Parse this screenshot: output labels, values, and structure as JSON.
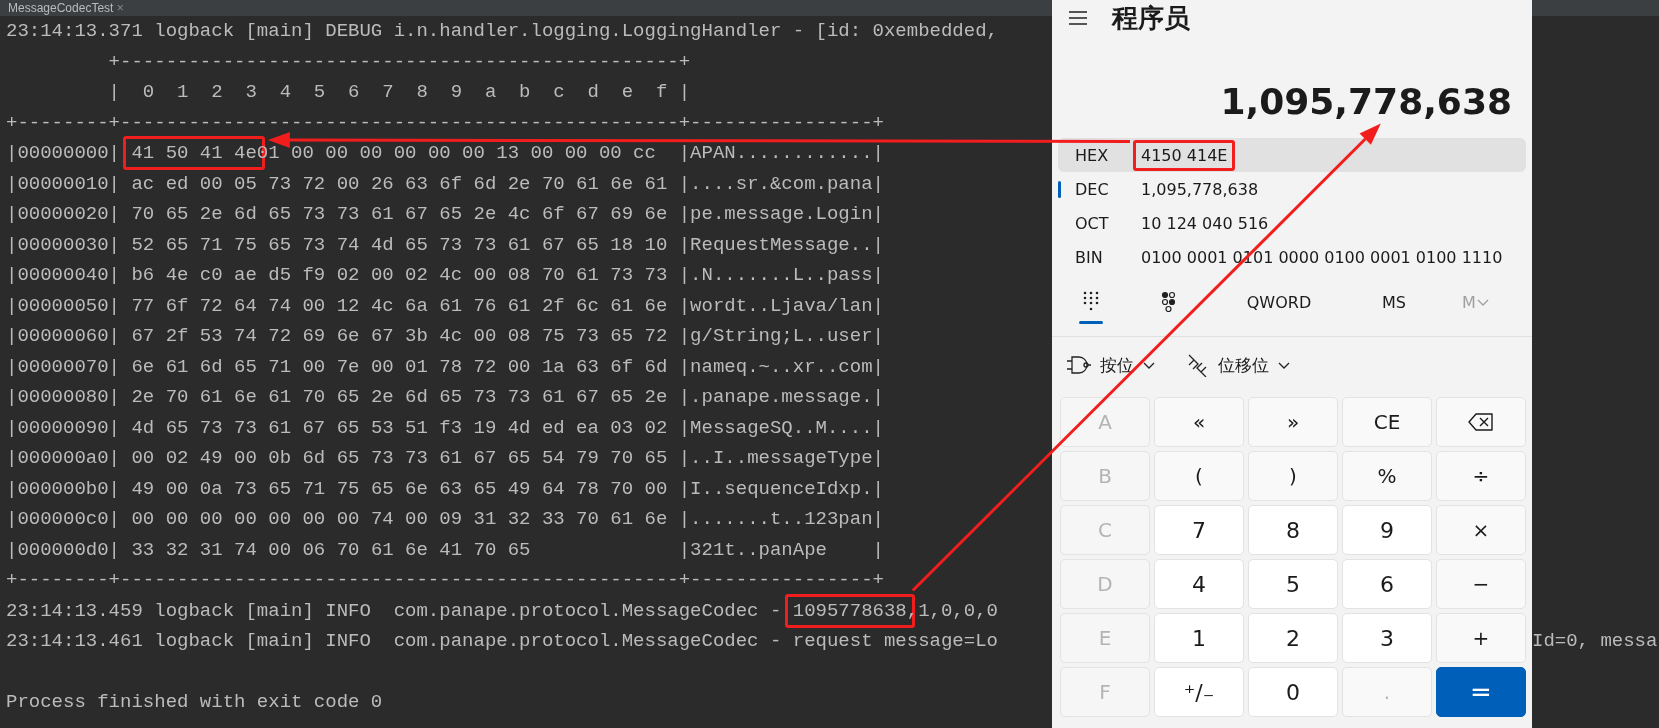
{
  "tab": {
    "title": "MessageCodecTest",
    "close": "×"
  },
  "console": {
    "lines": [
      {
        "kind": "text",
        "text": "23:14:13.371 logback [main] DEBUG i.n.handler.logging.LoggingHandler - [id: 0xembedded,"
      },
      {
        "kind": "text",
        "text": "         +-------------------------------------------------+"
      },
      {
        "kind": "text",
        "text": "         |  0  1  2  3  4  5  6  7  8  9  a  b  c  d  e  f |"
      },
      {
        "kind": "text",
        "text": "+--------+-------------------------------------------------+----------------+"
      },
      {
        "kind": "hex",
        "address": "|00000000|",
        "marked": "41 50 41 4e",
        "bytes": "01 00 00 00 00 00 00 13 00 00 00 cc",
        "ascii": "|APAN............|"
      },
      {
        "kind": "hex",
        "address": "|00000010|",
        "bytes": "ac ed 00 05 73 72 00 26 63 6f 6d 2e 70 61 6e 61",
        "ascii": "|....sr.&com.pana|"
      },
      {
        "kind": "hex",
        "address": "|00000020|",
        "bytes": "70 65 2e 6d 65 73 73 61 67 65 2e 4c 6f 67 69 6e",
        "ascii": "|pe.message.Login|"
      },
      {
        "kind": "hex",
        "address": "|00000030|",
        "bytes": "52 65 71 75 65 73 74 4d 65 73 73 61 67 65 18 10",
        "ascii": "|RequestMessage..|"
      },
      {
        "kind": "hex",
        "address": "|00000040|",
        "bytes": "b6 4e c0 ae d5 f9 02 00 02 4c 00 08 70 61 73 73",
        "ascii": "|.N.......L..pass|"
      },
      {
        "kind": "hex",
        "address": "|00000050|",
        "bytes": "77 6f 72 64 74 00 12 4c 6a 61 76 61 2f 6c 61 6e",
        "ascii": "|wordt..Ljava/lan|"
      },
      {
        "kind": "hex",
        "address": "|00000060|",
        "bytes": "67 2f 53 74 72 69 6e 67 3b 4c 00 08 75 73 65 72",
        "ascii": "|g/String;L..user|"
      },
      {
        "kind": "hex",
        "address": "|00000070|",
        "bytes": "6e 61 6d 65 71 00 7e 00 01 78 72 00 1a 63 6f 6d",
        "ascii": "|nameq.~..xr..com|"
      },
      {
        "kind": "hex",
        "address": "|00000080|",
        "bytes": "2e 70 61 6e 61 70 65 2e 6d 65 73 73 61 67 65 2e",
        "ascii": "|.panape.message.|"
      },
      {
        "kind": "hex",
        "address": "|00000090|",
        "bytes": "4d 65 73 73 61 67 65 53 51 f3 19 4d ed ea 03 02",
        "ascii": "|MessageSQ..M....|"
      },
      {
        "kind": "hex",
        "address": "|000000a0|",
        "bytes": "00 02 49 00 0b 6d 65 73 73 61 67 65 54 79 70 65",
        "ascii": "|..I..messageType|"
      },
      {
        "kind": "hex",
        "address": "|000000b0|",
        "bytes": "49 00 0a 73 65 71 75 65 6e 63 65 49 64 78 70 00",
        "ascii": "|I..sequenceIdxp.|"
      },
      {
        "kind": "hex",
        "address": "|000000c0|",
        "bytes": "00 00 00 00 00 00 00 74 00 09 31 32 33 70 61 6e",
        "ascii": "|.......t..123pan|"
      },
      {
        "kind": "hex",
        "address": "|000000d0|",
        "bytes": "33 32 31 74 00 06 70 61 6e 41 70 65",
        "ascii": "|321t..panApe    |"
      },
      {
        "kind": "text",
        "text": "+--------+-------------------------------------------------+----------------+"
      },
      {
        "kind": "log",
        "text": "23:14:13.459 logback [main] INFO  com.panape.protocol.MessageCodec - ",
        "marked": "1095778638",
        "rest": ",1,0,0,0"
      },
      {
        "kind": "log",
        "text": "23:14:13.461 logback [main] INFO  com.panape.protocol.MessageCodec - request message=Lo",
        "right": "Id=0, messa"
      },
      {
        "kind": "blank"
      },
      {
        "kind": "text",
        "text": "Process finished with exit code 0"
      }
    ]
  },
  "calculator": {
    "title": "程序员",
    "display": "1,095,778,638",
    "radix": [
      {
        "name": "HEX",
        "value": "4150 414E",
        "selected": false,
        "highlighted": true,
        "marked": true
      },
      {
        "name": "DEC",
        "value": "1,095,778,638",
        "selected": true,
        "highlighted": false,
        "marked": false
      },
      {
        "name": "OCT",
        "value": "10 124 040 516",
        "selected": false,
        "highlighted": false,
        "marked": false
      },
      {
        "name": "BIN",
        "value": "0100 0001 0101 0000 0100 0001 0100 1110",
        "selected": false,
        "highlighted": false,
        "marked": false
      }
    ],
    "toolbar": [
      {
        "kind": "keypad",
        "selected": true
      },
      {
        "kind": "bits",
        "selected": false
      },
      {
        "kind": "label",
        "label": "QWORD",
        "disabled": false
      },
      {
        "kind": "label",
        "label": "MS",
        "disabled": false
      },
      {
        "kind": "menu",
        "label": "M",
        "disabled": true
      }
    ],
    "dropdowns": [
      {
        "kind": "bitwise",
        "label": "按位"
      },
      {
        "kind": "shift",
        "label": "位移位"
      }
    ],
    "keys": [
      {
        "label": "A",
        "kind": "letter",
        "disabled": true
      },
      {
        "label": "«",
        "kind": "operator",
        "disabled": false
      },
      {
        "label": "»",
        "kind": "operator",
        "disabled": false
      },
      {
        "label": "CE",
        "kind": "operator",
        "disabled": false
      },
      {
        "kind": "backspace",
        "disabled": false
      },
      {
        "label": "B",
        "kind": "letter",
        "disabled": true
      },
      {
        "label": "(",
        "kind": "operator",
        "disabled": false
      },
      {
        "label": ")",
        "kind": "operator",
        "disabled": false
      },
      {
        "label": "%",
        "kind": "operator",
        "disabled": false
      },
      {
        "label": "÷",
        "kind": "operator",
        "disabled": false
      },
      {
        "label": "C",
        "kind": "letter",
        "disabled": true
      },
      {
        "label": "7",
        "kind": "digit",
        "disabled": false
      },
      {
        "label": "8",
        "kind": "digit",
        "disabled": false
      },
      {
        "label": "9",
        "kind": "digit",
        "disabled": false
      },
      {
        "label": "×",
        "kind": "operator",
        "disabled": false
      },
      {
        "label": "D",
        "kind": "letter",
        "disabled": true
      },
      {
        "label": "4",
        "kind": "digit",
        "disabled": false
      },
      {
        "label": "5",
        "kind": "digit",
        "disabled": false
      },
      {
        "label": "6",
        "kind": "digit",
        "disabled": false
      },
      {
        "label": "−",
        "kind": "operator",
        "disabled": false
      },
      {
        "label": "E",
        "kind": "letter",
        "disabled": true
      },
      {
        "label": "1",
        "kind": "digit",
        "disabled": false
      },
      {
        "label": "2",
        "kind": "digit",
        "disabled": false
      },
      {
        "label": "3",
        "kind": "digit",
        "disabled": false
      },
      {
        "label": "+",
        "kind": "operator",
        "disabled": false
      },
      {
        "label": "F",
        "kind": "letter",
        "disabled": true
      },
      {
        "label": "⁺∕₋",
        "kind": "digit",
        "disabled": false
      },
      {
        "label": "0",
        "kind": "digit",
        "disabled": false
      },
      {
        "label": ".",
        "kind": "operator",
        "disabled": true
      },
      {
        "label": "=",
        "kind": "equals",
        "disabled": false
      }
    ]
  }
}
